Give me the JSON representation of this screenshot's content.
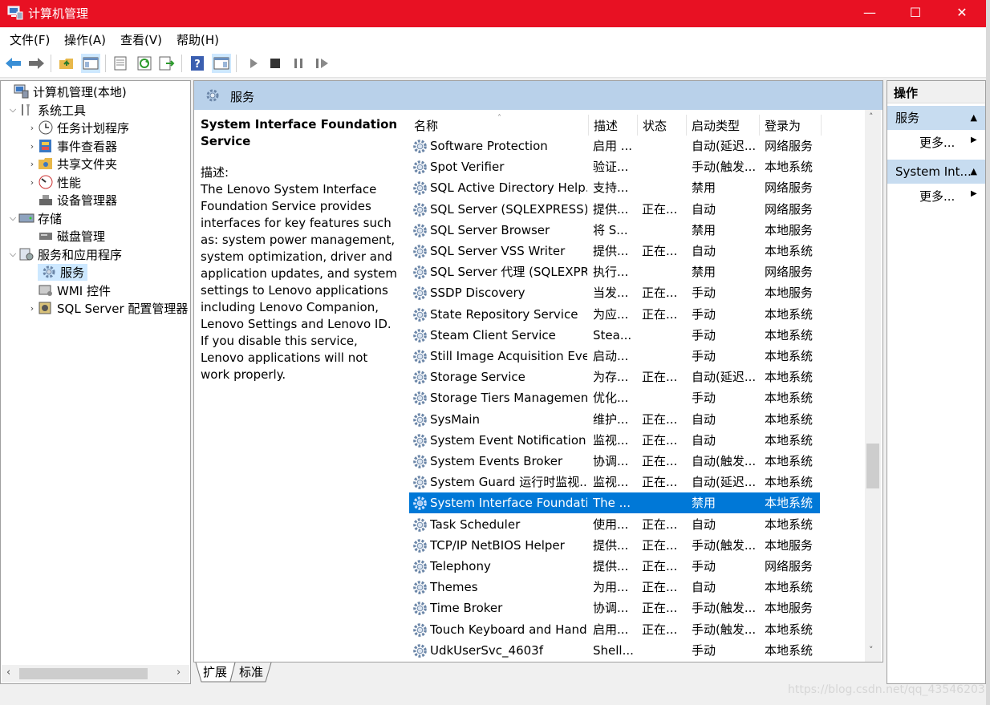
{
  "window": {
    "title": "计算机管理",
    "minimize": "—",
    "maximize": "☐",
    "close": "✕"
  },
  "menu": [
    "文件(F)",
    "操作(A)",
    "查看(V)",
    "帮助(H)"
  ],
  "tree": {
    "root": "计算机管理(本地)",
    "system_tools": "系统工具",
    "task_scheduler": "任务计划程序",
    "event_viewer": "事件查看器",
    "shared_folders": "共享文件夹",
    "performance": "性能",
    "device_manager": "设备管理器",
    "storage": "存储",
    "disk_management": "磁盘管理",
    "services_apps": "服务和应用程序",
    "services": "服务",
    "wmi": "WMI 控件",
    "sql_config": "SQL Server 配置管理器"
  },
  "center": {
    "header": "服务",
    "selected_title": "System Interface Foundation Service",
    "desc_label": "描述:",
    "desc_text": "The Lenovo System Interface Foundation Service provides interfaces for key features such as: system power management, system optimization, driver and application updates, and system settings to Lenovo applications including Lenovo Companion, Lenovo Settings and Lenovo ID. If you disable this service, Lenovo applications will not work properly."
  },
  "columns": {
    "name": "名称",
    "desc": "描述",
    "status": "状态",
    "startup": "启动类型",
    "logon": "登录为"
  },
  "services": [
    {
      "name": "Software Protection",
      "desc": "启用 ...",
      "status": "",
      "startup": "自动(延迟...",
      "logon": "网络服务"
    },
    {
      "name": "Spot Verifier",
      "desc": "验证...",
      "status": "",
      "startup": "手动(触发...",
      "logon": "本地系统"
    },
    {
      "name": "SQL Active Directory Help...",
      "desc": "支持...",
      "status": "",
      "startup": "禁用",
      "logon": "网络服务"
    },
    {
      "name": "SQL Server (SQLEXPRESS)",
      "desc": "提供...",
      "status": "正在...",
      "startup": "自动",
      "logon": "网络服务"
    },
    {
      "name": "SQL Server Browser",
      "desc": "将 S...",
      "status": "",
      "startup": "禁用",
      "logon": "本地服务"
    },
    {
      "name": "SQL Server VSS Writer",
      "desc": "提供...",
      "status": "正在...",
      "startup": "自动",
      "logon": "本地系统"
    },
    {
      "name": "SQL Server 代理 (SQLEXPR...",
      "desc": "执行...",
      "status": "",
      "startup": "禁用",
      "logon": "网络服务"
    },
    {
      "name": "SSDP Discovery",
      "desc": "当发...",
      "status": "正在...",
      "startup": "手动",
      "logon": "本地服务"
    },
    {
      "name": "State Repository Service",
      "desc": "为应...",
      "status": "正在...",
      "startup": "手动",
      "logon": "本地系统"
    },
    {
      "name": "Steam Client Service",
      "desc": "Stea...",
      "status": "",
      "startup": "手动",
      "logon": "本地系统"
    },
    {
      "name": "Still Image Acquisition Eve...",
      "desc": "启动...",
      "status": "",
      "startup": "手动",
      "logon": "本地系统"
    },
    {
      "name": "Storage Service",
      "desc": "为存...",
      "status": "正在...",
      "startup": "自动(延迟...",
      "logon": "本地系统"
    },
    {
      "name": "Storage Tiers Management",
      "desc": "优化...",
      "status": "",
      "startup": "手动",
      "logon": "本地系统"
    },
    {
      "name": "SysMain",
      "desc": "维护...",
      "status": "正在...",
      "startup": "自动",
      "logon": "本地系统"
    },
    {
      "name": "System Event Notification ...",
      "desc": "监视...",
      "status": "正在...",
      "startup": "自动",
      "logon": "本地系统"
    },
    {
      "name": "System Events Broker",
      "desc": "协调...",
      "status": "正在...",
      "startup": "自动(触发...",
      "logon": "本地系统"
    },
    {
      "name": "System Guard 运行时监视...",
      "desc": "监视...",
      "status": "正在...",
      "startup": "自动(延迟...",
      "logon": "本地系统"
    },
    {
      "name": "System Interface Foundati...",
      "desc": "The ...",
      "status": "",
      "startup": "禁用",
      "logon": "本地系统",
      "selected": true
    },
    {
      "name": "Task Scheduler",
      "desc": "使用...",
      "status": "正在...",
      "startup": "自动",
      "logon": "本地系统"
    },
    {
      "name": "TCP/IP NetBIOS Helper",
      "desc": "提供...",
      "status": "正在...",
      "startup": "手动(触发...",
      "logon": "本地服务"
    },
    {
      "name": "Telephony",
      "desc": "提供...",
      "status": "正在...",
      "startup": "手动",
      "logon": "网络服务"
    },
    {
      "name": "Themes",
      "desc": "为用...",
      "status": "正在...",
      "startup": "自动",
      "logon": "本地系统"
    },
    {
      "name": "Time Broker",
      "desc": "协调...",
      "status": "正在...",
      "startup": "手动(触发...",
      "logon": "本地服务"
    },
    {
      "name": "Touch Keyboard and Hand...",
      "desc": "启用...",
      "status": "正在...",
      "startup": "手动(触发...",
      "logon": "本地系统"
    },
    {
      "name": "UdkUserSvc_4603f",
      "desc": "Shell...",
      "status": "",
      "startup": "手动",
      "logon": "本地系统"
    }
  ],
  "tabs": [
    "扩展",
    "标准"
  ],
  "actions": {
    "header": "操作",
    "section1": "服务",
    "more1": "更多...",
    "section2": "System Int...",
    "more2": "更多..."
  },
  "watermark": "https://blog.csdn.net/qq_43546203",
  "colors": {
    "titlebar": "#e81123",
    "selection": "#0078d7",
    "pane_header": "#b9d1ea"
  }
}
